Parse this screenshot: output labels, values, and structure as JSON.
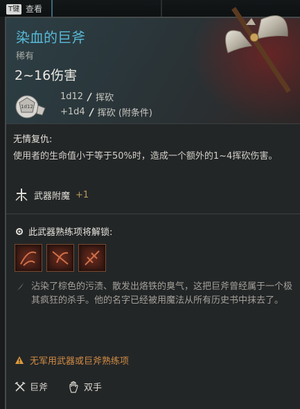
{
  "top_bar": {
    "key_hint": "T键",
    "view_label": "查看"
  },
  "item": {
    "name": "染血的巨斧",
    "rarity": "稀有",
    "damage_total": "2~16伤害",
    "dice_label": "1d12",
    "damage_rows": [
      {
        "dice": "1d12",
        "type": "挥砍"
      },
      {
        "dice": "+1d4",
        "type": "挥砍 (附条件)"
      }
    ],
    "passive": {
      "name": "无情复仇:",
      "description": "使用者的生命值小于等于50%时，造成一个额外的1~4挥砍伤害。"
    },
    "enchant": {
      "label": "武器附魔",
      "value": "+1"
    },
    "unlock": {
      "heading": "此武器熟练项将解锁:",
      "skills": [
        "skill-1-icon",
        "skill-2-icon",
        "skill-3-icon"
      ]
    },
    "flavor_text": "沾染了棕色的污渍、散发出烙铁的臭气，这把巨斧曾经属于一个极其疯狂的杀手。他的名字已经被用魔法从所有历史书中抹去了。",
    "warning": "无军用武器或巨斧熟练项",
    "tags": [
      {
        "icon": "crossed-axes-icon",
        "label": "巨斧"
      },
      {
        "icon": "hand-icon",
        "label": "双手"
      }
    ]
  },
  "colors": {
    "title": "#59b8d6",
    "warning": "#d28c45",
    "enchant_value": "#b89a5c"
  }
}
